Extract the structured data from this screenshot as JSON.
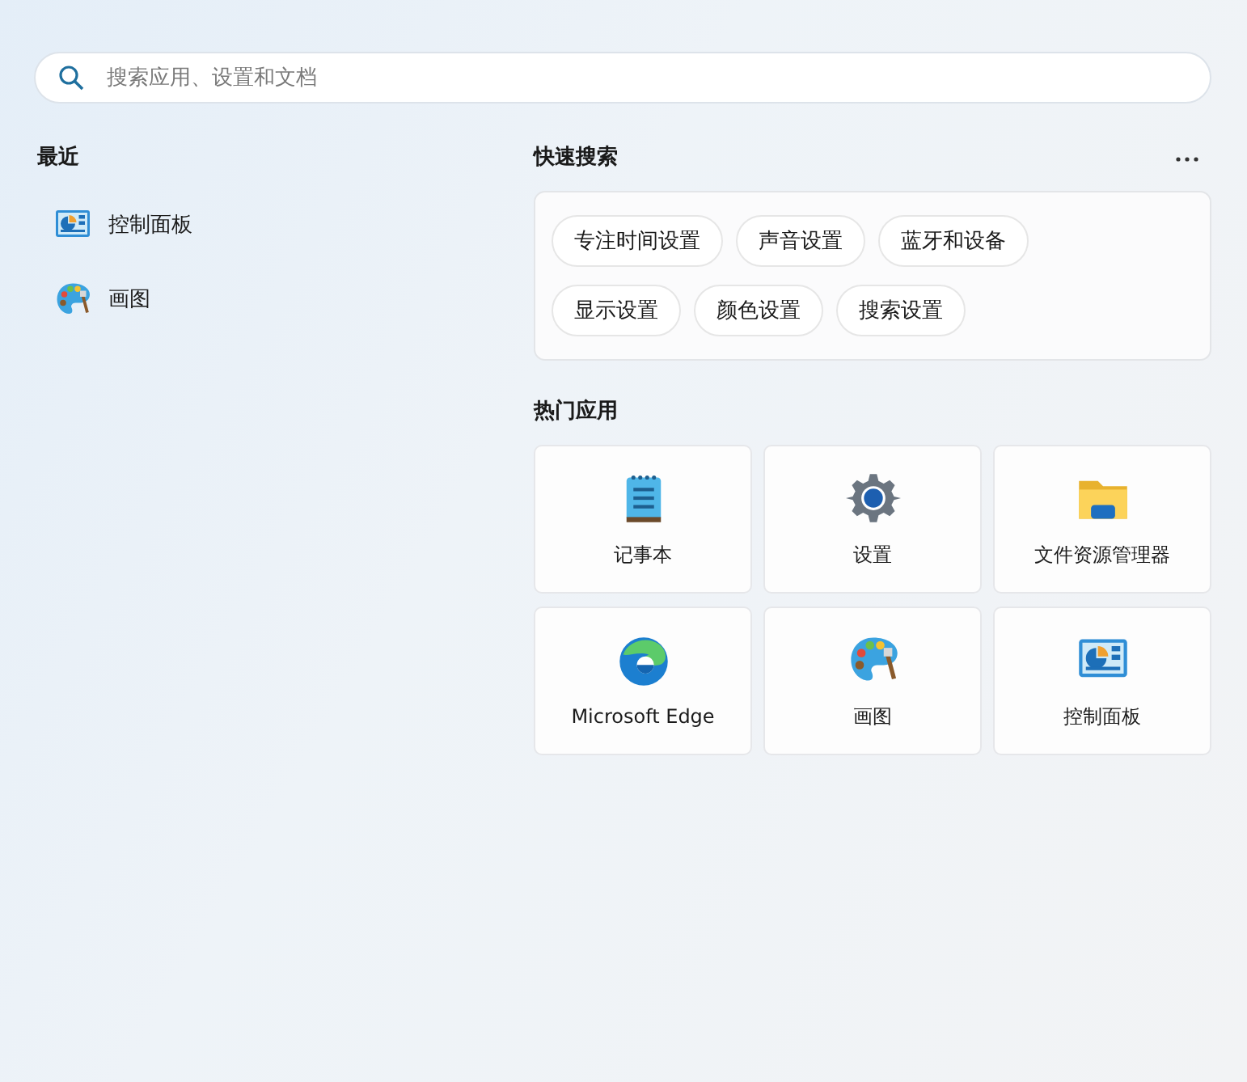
{
  "search": {
    "placeholder": "搜索应用、设置和文档"
  },
  "recent": {
    "title": "最近",
    "items": [
      {
        "label": "控制面板",
        "kind": "control-panel"
      },
      {
        "label": "画图",
        "kind": "paint"
      }
    ]
  },
  "quick_search": {
    "title": "快速搜索",
    "chips": [
      {
        "label": "专注时间设置"
      },
      {
        "label": "声音设置"
      },
      {
        "label": "蓝牙和设备"
      },
      {
        "label": "显示设置"
      },
      {
        "label": "颜色设置"
      },
      {
        "label": "搜索设置"
      }
    ]
  },
  "top_apps": {
    "title": "热门应用",
    "apps": [
      {
        "label": "记事本",
        "kind": "notepad"
      },
      {
        "label": "设置",
        "kind": "settings"
      },
      {
        "label": "文件资源管理器",
        "kind": "folder"
      },
      {
        "label": "Microsoft Edge",
        "kind": "edge"
      },
      {
        "label": "画图",
        "kind": "paint"
      },
      {
        "label": "控制面板",
        "kind": "control-panel"
      }
    ]
  }
}
